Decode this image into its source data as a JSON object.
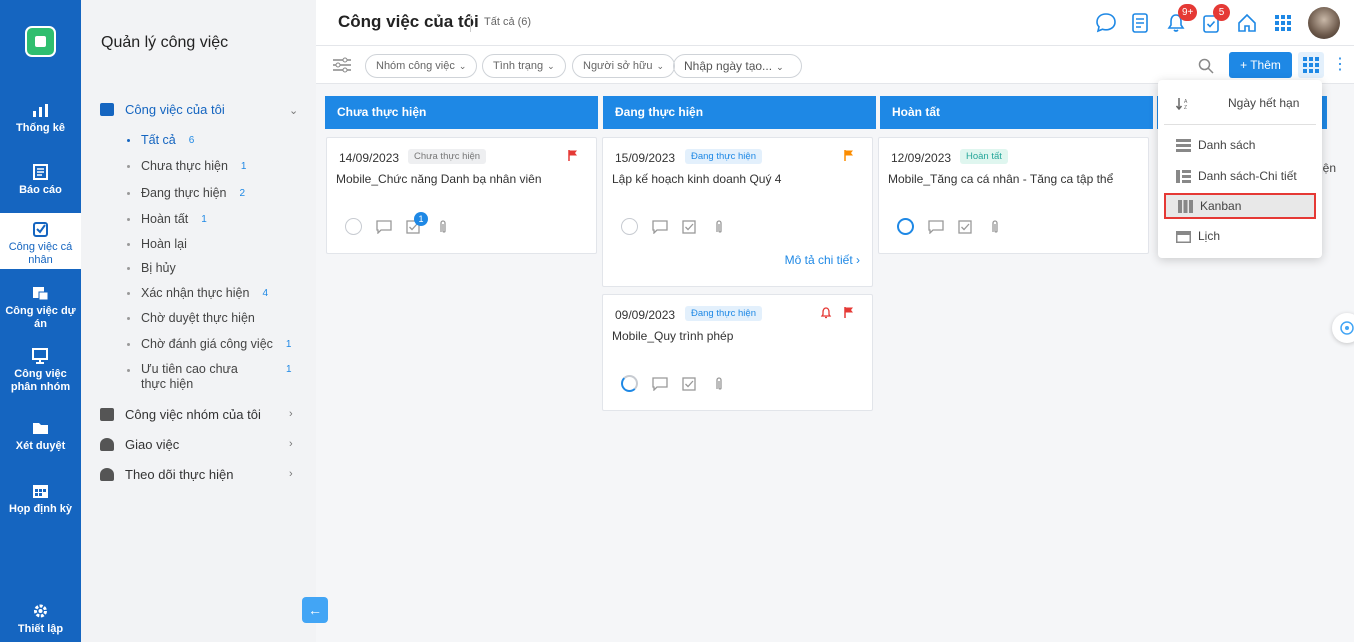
{
  "rail": {
    "items": [
      {
        "label": "Thống kê"
      },
      {
        "label": "Báo cáo"
      },
      {
        "label": "Công việc cá nhân"
      },
      {
        "label": "Công việc dự án"
      },
      {
        "label": "Công việc phân nhóm"
      },
      {
        "label": "Xét duyệt"
      },
      {
        "label": "Họp định kỳ"
      },
      {
        "label": "Thiết lập"
      }
    ]
  },
  "sidebar": {
    "title": "Quản lý công việc",
    "groups": [
      {
        "label": "Công việc của tôi"
      },
      {
        "label": "Công việc nhóm của tôi"
      },
      {
        "label": "Giao việc"
      },
      {
        "label": "Theo dõi thực hiện"
      }
    ],
    "sub_items": [
      {
        "label": "Tất cả",
        "count": "6"
      },
      {
        "label": "Chưa thực hiện",
        "count": "1"
      },
      {
        "label": "Đang thực hiện",
        "count": "2"
      },
      {
        "label": "Hoàn tất",
        "count": "1"
      },
      {
        "label": "Hoàn lại",
        "count": ""
      },
      {
        "label": "Bị hủy",
        "count": ""
      },
      {
        "label": "Xác nhận thực hiện",
        "count": "4"
      },
      {
        "label": "Chờ duyệt thực hiện",
        "count": ""
      },
      {
        "label": "Chờ đánh giá công việc",
        "count": "1"
      },
      {
        "label": "Ưu tiên cao chưa thực hiện",
        "count": "1"
      }
    ]
  },
  "header": {
    "title": "Công việc của tôi",
    "subtitle": "Tất cả (6)",
    "notif_badge": "9+",
    "task_badge": "5"
  },
  "filters": {
    "group": "Nhóm công việc",
    "status": "Tình trạng",
    "owner": "Người sở hữu",
    "date_placeholder": "Nhập ngày tạo...",
    "add_label": "+ Thêm"
  },
  "columns": [
    {
      "title": "Chưa thực hiện"
    },
    {
      "title": "Đang thực hiện"
    },
    {
      "title": "Hoàn tất"
    }
  ],
  "cards": [
    {
      "date": "14/09/2023",
      "status": "Chưa thực hiện",
      "title": "Mobile_Chức năng Danh bạ nhân viên",
      "checklist_badge": "1"
    },
    {
      "date": "15/09/2023",
      "status": "Đang thực hiện",
      "title": "Lập kế hoạch kinh doanh Quý 4",
      "more": "Mô tả chi tiết ›"
    },
    {
      "date": "09/09/2023",
      "status": "Đang thực hiện",
      "title": "Mobile_Quy trình phép"
    },
    {
      "date": "12/09/2023",
      "status": "Hoàn tất",
      "title": "Mobile_Tăng ca cá nhân - Tăng ca tập thể"
    }
  ],
  "view_menu": {
    "sort_label": "Ngày hết hạn",
    "items": [
      {
        "label": "Danh sách"
      },
      {
        "label": "Danh sách-Chi tiết"
      },
      {
        "label": "Kanban"
      },
      {
        "label": "Lịch"
      }
    ]
  },
  "cut_text": "iện",
  "colors": {
    "primary": "#1e88e5",
    "rail": "#1565c0",
    "danger": "#e53935",
    "highlight_border": "#e53935"
  }
}
